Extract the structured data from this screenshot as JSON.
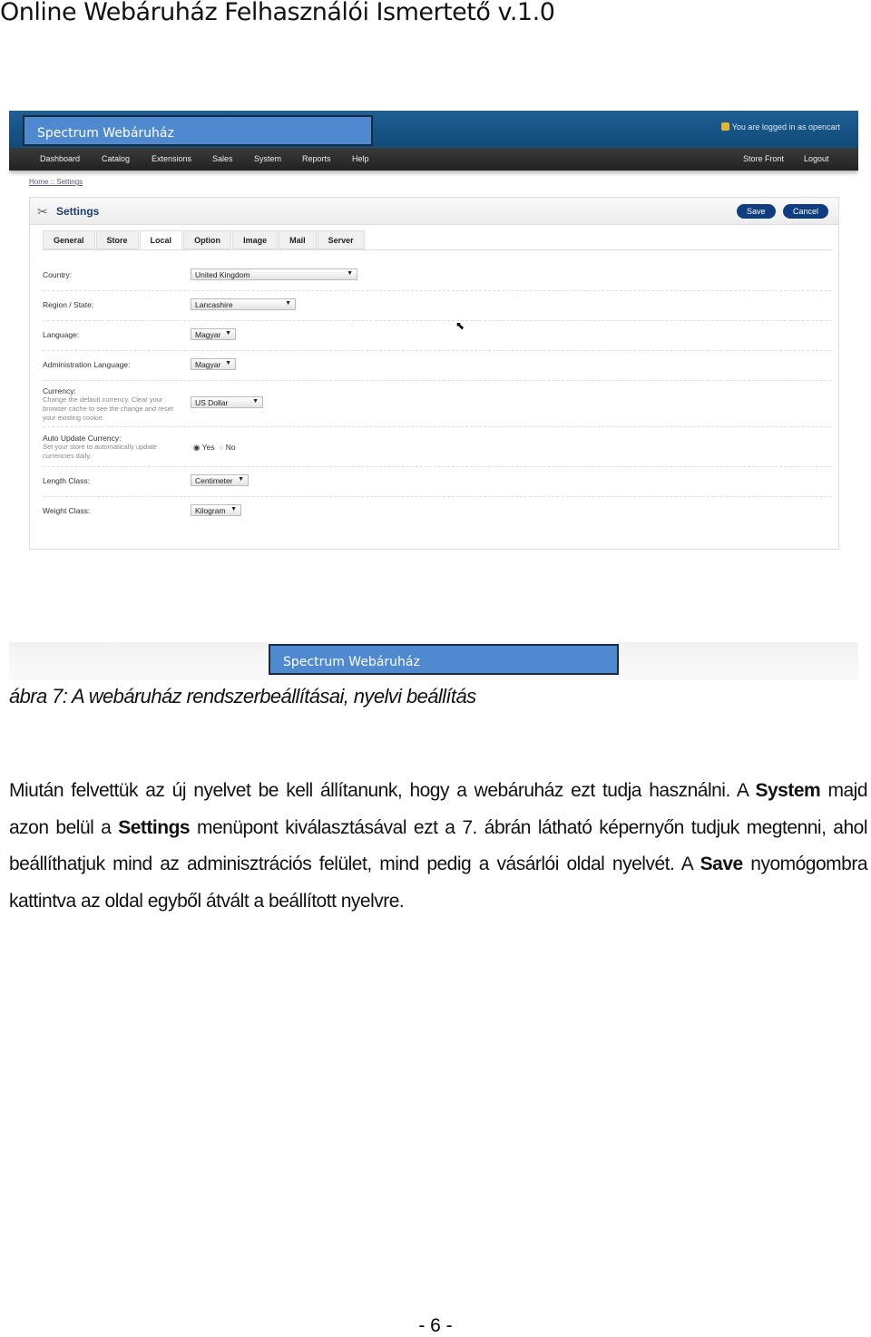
{
  "doc_title": "Online Webáruház Felhasználói Ismertető  v.1.0",
  "shot": {
    "brand": "Spectrum Webáruház",
    "logged_in": "You are logged in as opencart",
    "nav": [
      "Dashboard",
      "Catalog",
      "Extensions",
      "Sales",
      "System",
      "Reports",
      "Help"
    ],
    "nav_right": [
      "Store Front",
      "Logout"
    ],
    "breadcrumb": "Home :: Settings",
    "panel_title": "Settings",
    "save": "Save",
    "cancel": "Cancel",
    "tabs": [
      "General",
      "Store",
      "Local",
      "Option",
      "Image",
      "Mail",
      "Server"
    ],
    "active_tab": "Local",
    "fields": {
      "country": {
        "label": "Country:",
        "value": "United Kingdom"
      },
      "region": {
        "label": "Region / State:",
        "value": "Lancashire"
      },
      "language": {
        "label": "Language:",
        "value": "Magyar"
      },
      "admin_language": {
        "label": "Administration Language:",
        "value": "Magyar"
      },
      "currency": {
        "label": "Currency:",
        "hint": "Change the default currency. Clear your browser cache to see the change and reset your existing cookie.",
        "value": "US Dollar"
      },
      "auto_update": {
        "label": "Auto Update Currency:",
        "hint": "Set your store to automatically update currencies daily.",
        "yes": "Yes",
        "no": "No",
        "selected": "Yes"
      },
      "length": {
        "label": "Length Class:",
        "value": "Centimeter"
      },
      "weight": {
        "label": "Weight Class:",
        "value": "Kilogram"
      }
    },
    "brand_bottom": "Spectrum Webáruház"
  },
  "caption": "ábra 7: A webáruház rendszerbeállításai, nyelvi beállítás",
  "para": {
    "p1": "Miután felvettük az új nyelvet be kell állítanunk, hogy a webáruház ezt tudja használni. A ",
    "b1": "System",
    "p2": " majd azon belül a ",
    "b2": "Settings",
    "p3": " menüpont kiválasztásával ezt a 7. ábrán látható képernyőn tudjuk megtenni, ahol beállíthatjuk mind az adminisztrációs felület, mind pedig a vásárlói oldal nyelvét. A ",
    "b3": "Save",
    "p4": " nyomógombra kattintva az oldal egyből átvált a beállított nyelvre."
  },
  "page_number": "- 6 -"
}
